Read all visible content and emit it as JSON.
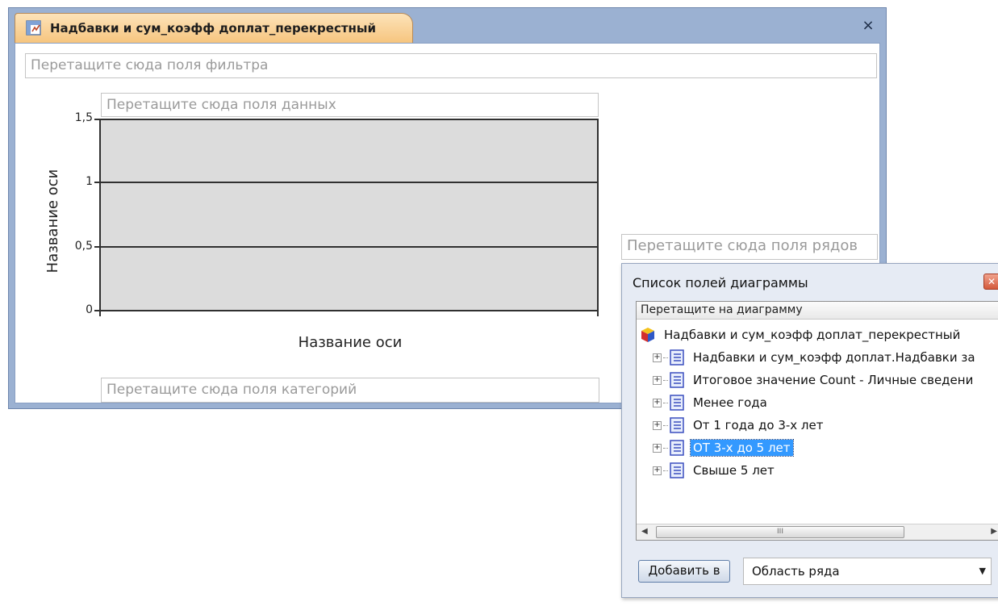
{
  "window": {
    "tab_title": "Надбавки и сум_коэфф доплат_перекрестный",
    "close_glyph": "×"
  },
  "dropzones": {
    "filter": "Перетащите сюда поля фильтра",
    "data": "Перетащите сюда поля данных",
    "series": "Перетащите сюда поля рядов",
    "category": "Перетащите сюда поля категорий"
  },
  "chart_data": {
    "type": "bar",
    "categories": [],
    "series": [],
    "y_ticks": [
      "1,5",
      "1",
      "0,5",
      "0"
    ],
    "ylim": [
      0,
      1.5
    ],
    "xlabel": "Название оси",
    "ylabel": "Название оси",
    "grid": true
  },
  "field_list": {
    "title": "Список полей диаграммы",
    "hint": "Перетащите на диаграмму",
    "root": "Надбавки и сум_коэфф доплат_перекрестный",
    "items": [
      {
        "label": "Надбавки и сум_коэфф доплат.Надбавки за",
        "selected": false
      },
      {
        "label": "Итоговое значение Count - Личные сведени",
        "selected": false
      },
      {
        "label": "Менее года",
        "selected": false
      },
      {
        "label": "От 1 года до 3-х лет",
        "selected": false
      },
      {
        "label": "ОТ 3-х до 5 лет",
        "selected": true
      },
      {
        "label": "Свыше 5 лет",
        "selected": false
      }
    ],
    "scroll_thumb_glyph": "III",
    "add_button": "Добавить в",
    "area_value": "Область ряда"
  },
  "colors": {
    "window_frame": "#9bb1d2",
    "tab_active": "#f6c57f",
    "plot_fill": "#dcdcdc",
    "selection": "#3399ff"
  }
}
